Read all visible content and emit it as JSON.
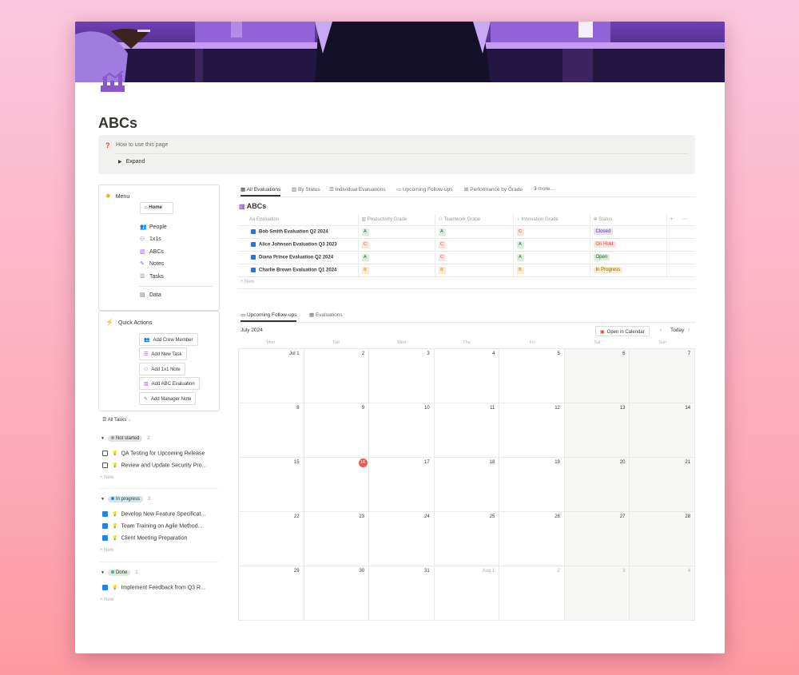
{
  "page": {
    "title": "ABCs",
    "callout": {
      "icon": "question-icon",
      "title": "How to use this page",
      "toggle": "Expand"
    }
  },
  "menu": {
    "heading": "Menu",
    "home": "Home",
    "items": [
      {
        "label": "People",
        "icon": "people-icon"
      },
      {
        "label": "1x1s",
        "icon": "two-people-icon"
      },
      {
        "label": "ABCs",
        "icon": "chart-icon"
      },
      {
        "label": "Notes",
        "icon": "edit-icon"
      },
      {
        "label": "Tasks",
        "icon": "checklist-icon"
      }
    ],
    "data": "Data"
  },
  "quick_actions": {
    "heading": "Quick Actions",
    "buttons": [
      "Add Crew Member",
      "Add New Task",
      "Add 1x1 Note",
      "Add ABC Evaluation",
      "Add Manager Note"
    ]
  },
  "tasks": {
    "view_label": "All Tasks",
    "new_label": "New",
    "groups": [
      {
        "status": "Not started",
        "count": "2",
        "color": "#9b9a97",
        "bg": "#e3e2e0",
        "items": [
          {
            "title": "QA Testing for Upcoming Release",
            "done": false
          },
          {
            "title": "Review and Update Security Pro...",
            "done": false
          }
        ]
      },
      {
        "status": "In progress",
        "count": "3",
        "color": "#2383e2",
        "bg": "#d3e5ef",
        "items": [
          {
            "title": "Develop New Feature Specificat...",
            "done": true
          },
          {
            "title": "Team Training on Agile Method...",
            "done": true
          },
          {
            "title": "Client Meeting Preparation",
            "done": true
          }
        ]
      },
      {
        "status": "Done",
        "count": "1",
        "color": "#4dab9a",
        "bg": "#dbeddb",
        "items": [
          {
            "title": "Implement Feedback from Q3 R...",
            "done": true
          }
        ]
      }
    ]
  },
  "evaluations": {
    "tabs": [
      "All Evaluations",
      "By Status",
      "Individual Evaluations",
      "Upcoming Follow-ups",
      "Performance by Grade",
      "3 more..."
    ],
    "db_title": "ABCs",
    "columns": [
      "Evaluation",
      "Productivity Grade",
      "Teamwork Grade",
      "Innovation Grade",
      "Status"
    ],
    "rows": [
      {
        "name": "Bob Smith Evaluation Q2 2024",
        "productivity": "A",
        "teamwork": "A",
        "innovation": "C",
        "status": "Closed"
      },
      {
        "name": "Alice Johnson Evaluation Q3 2023",
        "productivity": "C",
        "teamwork": "C",
        "innovation": "A",
        "status": "On Hold"
      },
      {
        "name": "Diana Prince Evaluation Q2 2024",
        "productivity": "A",
        "teamwork": "C",
        "innovation": "A",
        "status": "Open"
      },
      {
        "name": "Charlie Brown Evaluation Q1 2024",
        "productivity": "B",
        "teamwork": "B",
        "innovation": "B",
        "status": "In Progress"
      }
    ],
    "new_label": "New"
  },
  "calendar": {
    "tabs": [
      "Upcoming Follow-ups",
      "Evaluations"
    ],
    "month": "July 2024",
    "open_button": "Open in Calendar",
    "today": "Today",
    "weekdays": [
      "Mon",
      "Tue",
      "Wed",
      "Thu",
      "Fri",
      "Sat",
      "Sun"
    ],
    "weeks": [
      [
        "Jul 1",
        "2",
        "3",
        "4",
        "5",
        "6",
        "7"
      ],
      [
        "8",
        "9",
        "10",
        "11",
        "12",
        "13",
        "14"
      ],
      [
        "15",
        "16",
        "17",
        "18",
        "19",
        "20",
        "21"
      ],
      [
        "22",
        "23",
        "24",
        "25",
        "26",
        "27",
        "28"
      ],
      [
        "29",
        "30",
        "31",
        "Aug 1",
        "2",
        "3",
        "4"
      ]
    ],
    "current_day": "16"
  }
}
